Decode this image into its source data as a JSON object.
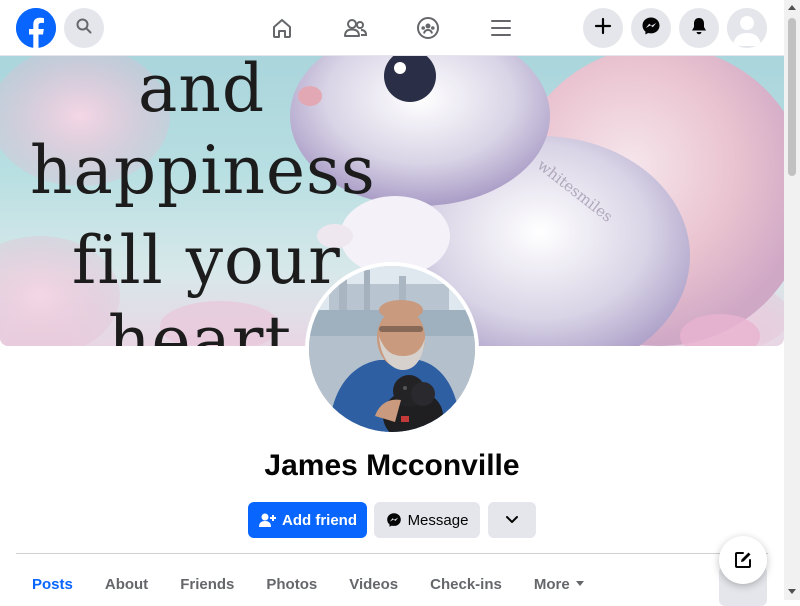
{
  "topbar": {
    "logo_icon": "facebook-logo-icon",
    "search_icon": "search-icon",
    "nav_icons": [
      "home-icon",
      "friends-icon",
      "groups-icon",
      "menu-icon"
    ],
    "right_icons": [
      "plus-icon",
      "messenger-icon",
      "bell-icon",
      "user-avatar-icon"
    ],
    "accent": "#0866ff"
  },
  "cover": {
    "lines": [
      "and",
      "happiness",
      "fill your",
      "heart"
    ],
    "watermark": "whitesmiles"
  },
  "profile": {
    "name": "James Mcconville"
  },
  "actions": {
    "add_friend": "Add friend",
    "message": "Message",
    "more_icon": "chevron-down-icon"
  },
  "tabs": [
    {
      "label": "Posts",
      "active": true
    },
    {
      "label": "About"
    },
    {
      "label": "Friends"
    },
    {
      "label": "Photos"
    },
    {
      "label": "Videos"
    },
    {
      "label": "Check-ins"
    },
    {
      "label": "More"
    }
  ],
  "fab_icon": "compose-icon"
}
